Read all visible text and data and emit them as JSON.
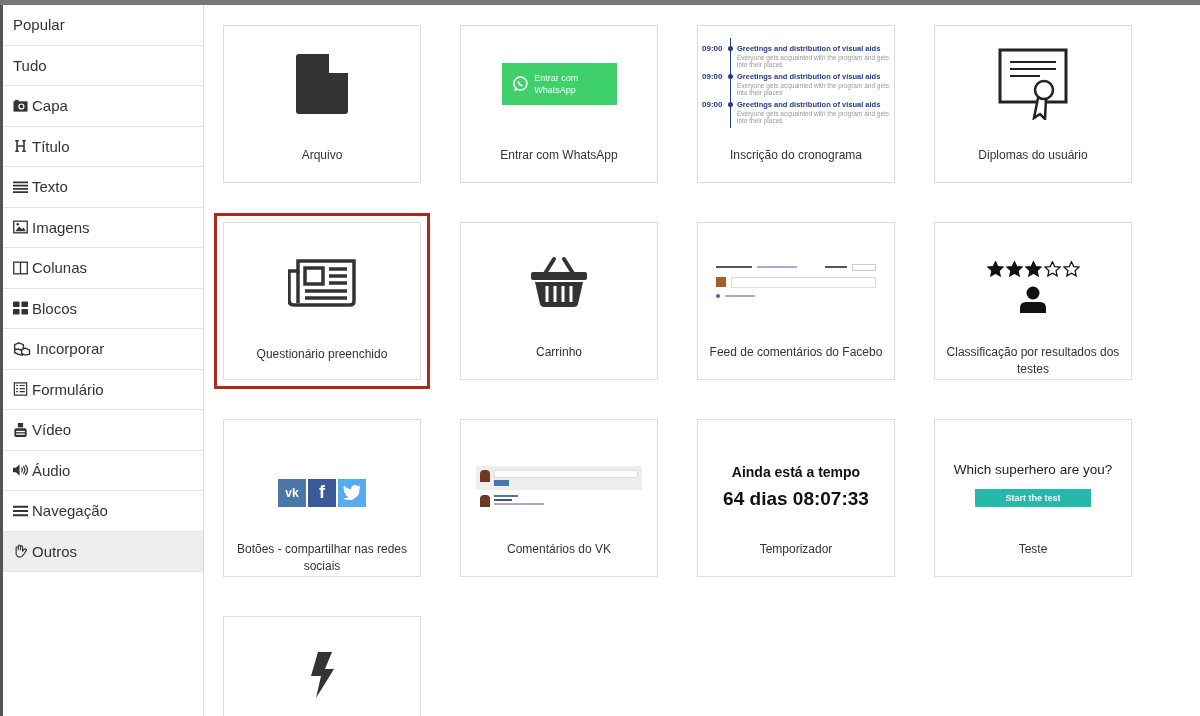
{
  "sidebar": {
    "items": [
      {
        "label": "Popular",
        "kind": "plain",
        "selected": false
      },
      {
        "label": "Tudo",
        "kind": "plain",
        "selected": false
      },
      {
        "label": "Capa",
        "kind": "camera",
        "selected": false
      },
      {
        "label": "Título",
        "kind": "heading",
        "selected": false
      },
      {
        "label": "Texto",
        "kind": "lines",
        "selected": false
      },
      {
        "label": "Imagens",
        "kind": "image",
        "selected": false
      },
      {
        "label": "Colunas",
        "kind": "columns",
        "selected": false
      },
      {
        "label": "Blocos",
        "kind": "blocks",
        "selected": false
      },
      {
        "label": "Incorporar",
        "kind": "cubes",
        "selected": false
      },
      {
        "label": "Formulário",
        "kind": "form",
        "selected": false
      },
      {
        "label": "Vídeo",
        "kind": "video",
        "selected": false
      },
      {
        "label": "Áudio",
        "kind": "audio",
        "selected": false
      },
      {
        "label": "Navegação",
        "kind": "menu",
        "selected": false
      },
      {
        "label": "Outros",
        "kind": "hand",
        "selected": true
      }
    ]
  },
  "tiles": [
    {
      "label": "Arquivo",
      "kind": "file",
      "selected": false
    },
    {
      "label": "Entrar com WhatsApp",
      "kind": "whatsapp",
      "selected": false,
      "button": "Entrar com WhatsApp"
    },
    {
      "label": "Inscrição do cronograma",
      "kind": "timeline",
      "selected": false,
      "entries": [
        {
          "time": "09:00",
          "title": "Greetings and distribution of visual aids",
          "text": "Everyone gets acquainted with the program and gets into their places"
        },
        {
          "time": "09:00",
          "title": "Greetings and distribution of visual aids",
          "text": "Everyone gets acquainted with the program and gets into their places"
        },
        {
          "time": "09:00",
          "title": "Greetings and distribution of visual aids",
          "text": "Everyone gets acquainted with the program and gets into their places"
        }
      ]
    },
    {
      "label": "Diplomas do usuário",
      "kind": "diploma",
      "selected": false
    },
    {
      "label": "Questionário preenchido",
      "kind": "newspaper",
      "selected": true
    },
    {
      "label": "Carrinho",
      "kind": "basket",
      "selected": false
    },
    {
      "label": "Feed de comentários do Facebo",
      "kind": "feed",
      "selected": false
    },
    {
      "label": "Classificação por resultados dos testes",
      "kind": "rating",
      "selected": false,
      "stars": 3
    },
    {
      "label": "Botões - compartilhar nas redes sociais",
      "kind": "social",
      "selected": false,
      "buttons": [
        "vk",
        "f"
      ]
    },
    {
      "label": "Comentários do VK",
      "kind": "comments",
      "selected": false
    },
    {
      "label": "Temporizador",
      "kind": "timer",
      "selected": false,
      "heading": "Ainda está a tempo",
      "countdown": "64 dias 08:07:33"
    },
    {
      "label": "Teste",
      "kind": "quiz",
      "selected": false,
      "question": "Which superhero are you?",
      "button": "Start the test"
    },
    {
      "kind": "bolt",
      "selected": false
    }
  ]
}
